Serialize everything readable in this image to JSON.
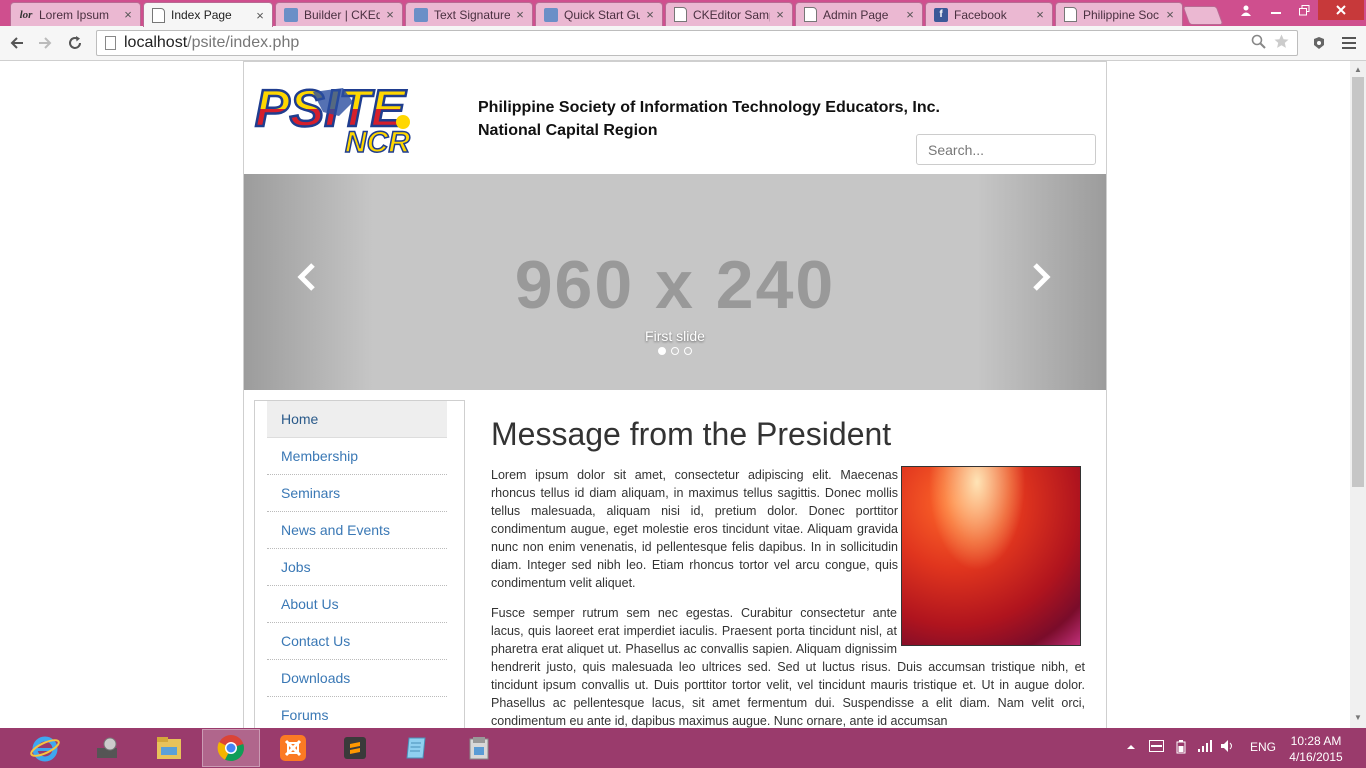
{
  "browser": {
    "tabs": [
      {
        "label": "Lorem Ipsum",
        "favicon": "lorem-favicon",
        "active": false
      },
      {
        "label": "Index Page",
        "favicon": "page-favicon",
        "active": true
      },
      {
        "label": "Builder | CKEd",
        "favicon": "doc-favicon",
        "active": false
      },
      {
        "label": "Text Signature",
        "favicon": "doc-favicon",
        "active": false
      },
      {
        "label": "Quick Start Gu",
        "favicon": "doc-favicon",
        "active": false
      },
      {
        "label": "CKEditor Samp",
        "favicon": "page-favicon",
        "active": false
      },
      {
        "label": "Admin Page",
        "favicon": "page-favicon",
        "active": false
      },
      {
        "label": "Facebook",
        "favicon": "facebook-favicon",
        "active": false
      },
      {
        "label": "Philippine Soc",
        "favicon": "page-favicon",
        "active": false
      }
    ],
    "favicon_glyphs": {
      "lorem": "lor",
      "facebook": "f"
    },
    "close_glyph": "×",
    "url_host": "localhost",
    "url_path": "/psite/index.php",
    "theme_color": "#cf4f8e"
  },
  "page": {
    "logo_text_top": "PSITE",
    "logo_text_bottom": "NCR",
    "org_name": "Philippine Society of Information Technology Educators, Inc.",
    "org_region": "National Capital Region",
    "search_placeholder": "Search...",
    "carousel": {
      "placeholder": "960 x 240",
      "caption": "First slide",
      "slide_count": 3,
      "active_index": 0
    },
    "nav": [
      {
        "label": "Home",
        "active": true
      },
      {
        "label": "Membership",
        "active": false
      },
      {
        "label": "Seminars",
        "active": false
      },
      {
        "label": "News and Events",
        "active": false
      },
      {
        "label": "Jobs",
        "active": false
      },
      {
        "label": "About Us",
        "active": false
      },
      {
        "label": "Contact Us",
        "active": false
      },
      {
        "label": "Downloads",
        "active": false
      },
      {
        "label": "Forums",
        "active": false
      }
    ],
    "heading": "Message from the President",
    "paragraphs": [
      "Lorem ipsum dolor sit amet, consectetur adipiscing elit. Maecenas rhoncus tellus id diam aliquam, in maximus tellus sagittis. Donec mollis tellus malesuada, aliquam nisi id, pretium dolor. Donec porttitor condimentum augue, eget molestie eros tincidunt vitae. Aliquam gravida nunc non enim venenatis, id pellentesque felis dapibus. In in sollicitudin diam. Integer sed nibh leo. Etiam rhoncus tortor vel arcu congue, quis condimentum velit aliquet.",
      "Fusce semper rutrum sem nec egestas. Curabitur consectetur ante lacus, quis laoreet erat imperdiet iaculis. Praesent porta tincidunt nisl, at pharetra erat aliquet ut. Phasellus ac convallis sapien. Aliquam dignissim hendrerit justo, quis malesuada leo ultrices sed. Sed ut luctus risus. Duis accumsan tristique nibh, et tincidunt ipsum convallis ut. Duis porttitor tortor velit, vel tincidunt mauris tristique et. Ut in augue dolor. Phasellus ac pellentesque lacus, sit amet fermentum dui. Suspendisse a elit diam. Nam velit orci, condimentum eu ante id, dapibus maximus augue. Nunc ornare, ante id accumsan"
    ],
    "link_color": "#3a78b5"
  },
  "taskbar": {
    "apps": [
      "internet-explorer",
      "settings-tool",
      "file-explorer",
      "chrome",
      "xampp",
      "sublime-text",
      "notepad",
      "installer"
    ],
    "active_app": "chrome",
    "language": "ENG",
    "time": "10:28 AM",
    "date": "4/16/2015",
    "color": "#9a3b6c"
  }
}
